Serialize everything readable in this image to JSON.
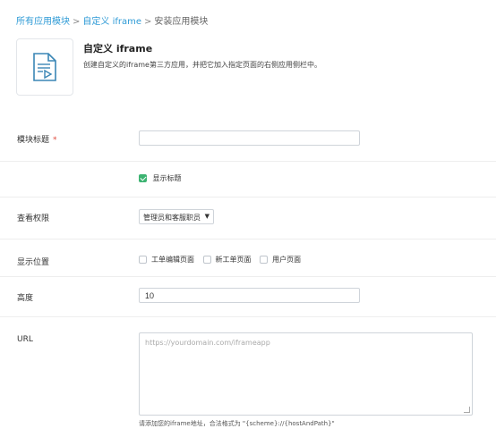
{
  "breadcrumb": {
    "items": [
      "所有应用模块",
      "自定义 iframe",
      "安装应用模块"
    ],
    "separator": ">"
  },
  "app": {
    "title": "自定义 iframe",
    "description": "创建自定义的iframe第三方应用，并把它加入指定页面的右侧应用侧栏中。",
    "icon": "document-video-icon"
  },
  "form": {
    "module_title": {
      "label": "模块标题",
      "required_mark": "*",
      "value": ""
    },
    "show_title": {
      "label": "显示标题",
      "checked": true
    },
    "permission": {
      "label": "查看权限",
      "selected": "管理员和客服职员"
    },
    "display_position": {
      "label": "显示位置",
      "options": [
        {
          "label": "工单编辑页面",
          "checked": false
        },
        {
          "label": "新工单页面",
          "checked": false
        },
        {
          "label": "用户页面",
          "checked": false
        }
      ]
    },
    "height": {
      "label": "高度",
      "value": "10"
    },
    "url": {
      "label": "URL",
      "placeholder": "https://yourdomain.com/iframeapp",
      "help": "请添加您的iframe地址，合法格式为 \"{scheme}://{hostAndPath}\""
    }
  },
  "colors": {
    "link": "#2f9bd6",
    "checkbox_checked": "#3cb371",
    "required": "#e0493b",
    "divider": "#eeeeee"
  }
}
